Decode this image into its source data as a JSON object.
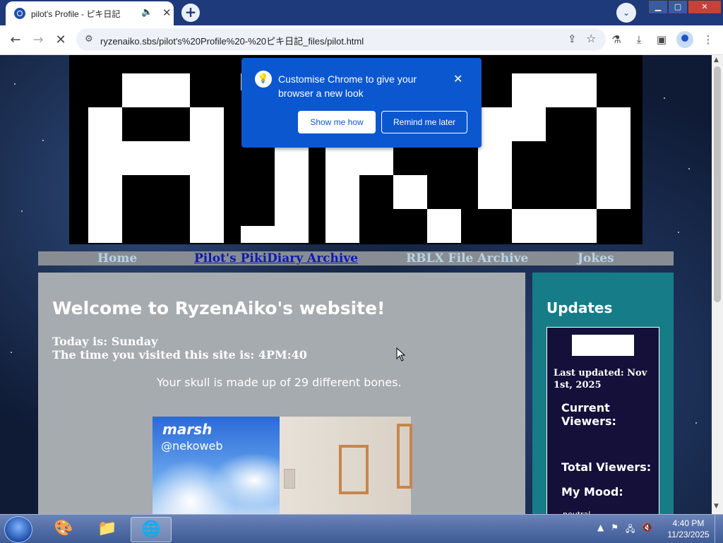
{
  "browser": {
    "tab": {
      "title": "pilot's Profile - ピキ日記",
      "audio_icon": "speaker-icon",
      "close_glyph": "✕"
    },
    "new_tab_glyph": "+",
    "tab_search_glyph": "⌄",
    "url": "ryzenaiko.sbs/pilot's%20Profile%20-%20ピキ日記_files/pilot.html",
    "window_buttons": {
      "minimize": "▁",
      "maximize": "▢",
      "close": "✕"
    }
  },
  "popup": {
    "message": "Customise Chrome to give your browser a new look",
    "primary_button": "Show me how",
    "secondary_button": "Remind me later",
    "close_glyph": "✕"
  },
  "site": {
    "nav": {
      "home": "Home",
      "archive": "Pilot's PikiDiary Archive",
      "rblx": "RBLX File Archive",
      "jokes": "Jokes"
    },
    "main": {
      "heading": "Welcome to RyzenAiko's website!",
      "today": "Today is: Sunday",
      "visit_time": "The time you visited this site is: 4PM:40",
      "fact": "Your skull is made up of 29 different bones.",
      "image_caption_name": "marsh",
      "image_caption_handle": "@nekoweb"
    },
    "sidebar": {
      "heading": "Updates",
      "last_updated": "Last updated: Nov 1st, 2025",
      "current_viewers": "Current Viewers:",
      "total_viewers": "Total Viewers:",
      "my_mood": "My Mood:",
      "mood_value": "neutral"
    }
  },
  "taskbar": {
    "time": "4:40 PM",
    "date": "11/23/2025"
  },
  "colors": {
    "chrome_blue": "#0b57d0",
    "tabstrip": "#1f3a7a",
    "content_panel": "#a6abb0",
    "sidebar_panel": "#167d88",
    "nav_active_link": "#0b1bb0"
  }
}
